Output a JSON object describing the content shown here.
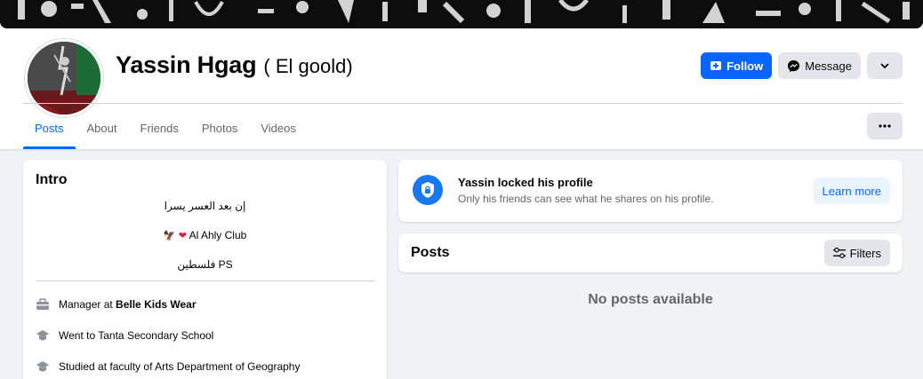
{
  "profile": {
    "name": "Yassin Hgag",
    "alternate_name": "( El goold)"
  },
  "actions": {
    "follow_label": "Follow",
    "message_label": "Message"
  },
  "tabs": [
    {
      "label": "Posts",
      "active": true
    },
    {
      "label": "About",
      "active": false
    },
    {
      "label": "Friends",
      "active": false
    },
    {
      "label": "Photos",
      "active": false
    },
    {
      "label": "Videos",
      "active": false
    }
  ],
  "intro": {
    "title": "Intro",
    "bio_lines": [
      "إن بعد العسر يسرا",
      "Al Ahly Club",
      "فلسطين PS"
    ],
    "details": [
      {
        "icon": "briefcase-icon",
        "prefix": "Manager at ",
        "highlight": "Belle Kids Wear"
      },
      {
        "icon": "graduation-cap-icon",
        "prefix": "Went to Tanta Secondary School",
        "highlight": ""
      },
      {
        "icon": "graduation-cap-icon",
        "prefix": "Studied at faculty of Arts Department of Geography",
        "highlight": ""
      }
    ]
  },
  "locked_notice": {
    "title": "Yassin locked his profile",
    "subtitle": "Only his friends can see what he shares on his profile.",
    "button_label": "Learn more"
  },
  "posts": {
    "title": "Posts",
    "filters_label": "Filters",
    "empty_message": "No posts available"
  },
  "colors": {
    "accent": "#0866ff",
    "secondary_button": "#e4e6eb",
    "background": "#f0f2f5"
  }
}
